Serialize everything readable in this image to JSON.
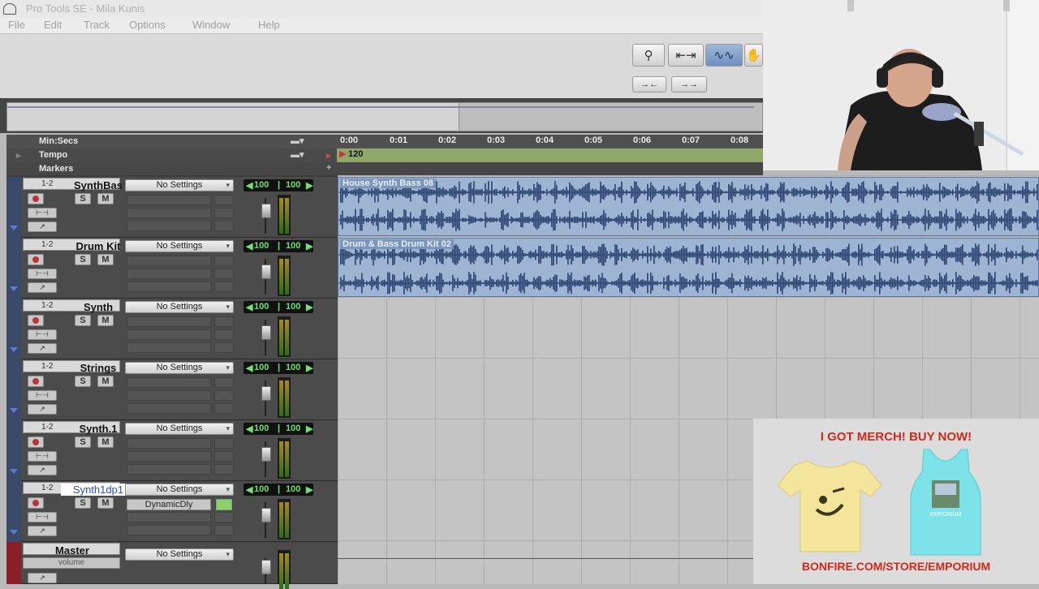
{
  "window": {
    "title": "Pro Tools SE - Mila Kunis"
  },
  "menu": [
    "File",
    "Edit",
    "Track",
    "Options",
    "Window",
    "Help"
  ],
  "timeline": {
    "ruler_label": "Min:Secs",
    "tempo_label": "Tempo",
    "markers_label": "Markers",
    "tempo_value": "120",
    "ticks": [
      "0:00",
      "0:01",
      "0:02",
      "0:03",
      "0:04",
      "0:05",
      "0:06",
      "0:07",
      "0:08"
    ]
  },
  "tracks": [
    {
      "chan": "1-2",
      "name": "SynthBas",
      "settings": "No Settings",
      "vol_l": "100",
      "vol_r": "100",
      "selected": false
    },
    {
      "chan": "1-2",
      "name": "Drum Kit",
      "settings": "No Settings",
      "vol_l": "100",
      "vol_r": "100",
      "selected": false
    },
    {
      "chan": "1-2",
      "name": "Synth",
      "settings": "No Settings",
      "vol_l": "100",
      "vol_r": "100",
      "selected": false
    },
    {
      "chan": "1-2",
      "name": "Strings",
      "settings": "No Settings",
      "vol_l": "100",
      "vol_r": "100",
      "selected": false
    },
    {
      "chan": "1-2",
      "name": "Synth.1",
      "settings": "No Settings",
      "vol_l": "100",
      "vol_r": "100",
      "selected": false
    },
    {
      "chan": "1-2",
      "name": "Synth1dp1",
      "settings": "No Settings",
      "vol_l": "100",
      "vol_r": "100",
      "selected": true,
      "plugin": "DynamicDly"
    }
  ],
  "master": {
    "name": "Master",
    "sub": "volume",
    "settings": "No Settings"
  },
  "track_buttons": {
    "solo": "S",
    "mute": "M"
  },
  "clips": [
    {
      "name": "House Synth Bass 08"
    },
    {
      "name": "Drum & Bass Drum Kit 02"
    }
  ],
  "merch": {
    "headline": "I GOT MERCH! BUY NOW!",
    "url": "BONFIRE.COM/STORE/EMPORIUM",
    "tank_text": "EMPORIUM"
  },
  "colors": {
    "tempo_bar": "#8fa86a",
    "clip": "#9db4d3",
    "merch_text": "#d02a1a",
    "volume_text": "#6fe36f"
  }
}
